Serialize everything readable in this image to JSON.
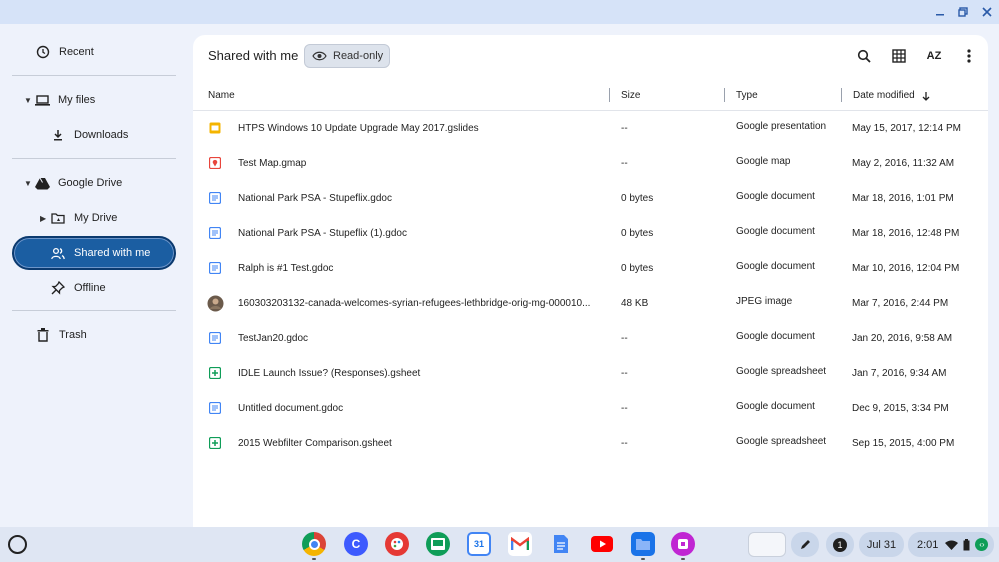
{
  "window": {
    "controls": [
      "minimize",
      "maximize",
      "close"
    ]
  },
  "sidebar": {
    "recent": "Recent",
    "my_files": "My files",
    "downloads": "Downloads",
    "google_drive": "Google Drive",
    "my_drive": "My Drive",
    "shared_with_me": "Shared with me",
    "offline": "Offline",
    "trash": "Trash"
  },
  "toolbar": {
    "title": "Shared with me",
    "read_only": "Read-only",
    "sort_label": "AZ"
  },
  "table": {
    "headers": {
      "name": "Name",
      "size": "Size",
      "type": "Type",
      "date": "Date modified"
    },
    "rows": [
      {
        "icon": "slides",
        "name": "HTPS Windows 10 Update Upgrade May 2017.gslides",
        "size": "--",
        "type": "Google presentation",
        "date": "May 15, 2017, 12:14 PM"
      },
      {
        "icon": "map",
        "name": "Test Map.gmap",
        "size": "--",
        "type": "Google map",
        "date": "May 2, 2016, 11:32 AM"
      },
      {
        "icon": "doc",
        "name": "National Park PSA - Stupeflix.gdoc",
        "size": "0 bytes",
        "type": "Google document",
        "date": "Mar 18, 2016, 1:01 PM"
      },
      {
        "icon": "doc",
        "name": "National Park PSA - Stupeflix (1).gdoc",
        "size": "0 bytes",
        "type": "Google document",
        "date": "Mar 18, 2016, 12:48 PM"
      },
      {
        "icon": "doc",
        "name": "Ralph is #1 Test.gdoc",
        "size": "0 bytes",
        "type": "Google document",
        "date": "Mar 10, 2016, 12:04 PM"
      },
      {
        "icon": "image",
        "name": "160303203132-canada-welcomes-syrian-refugees-lethbridge-orig-mg-000010...",
        "size": "48 KB",
        "type": "JPEG image",
        "date": "Mar 7, 2016, 2:44 PM"
      },
      {
        "icon": "doc",
        "name": "TestJan20.gdoc",
        "size": "--",
        "type": "Google document",
        "date": "Jan 20, 2016, 9:58 AM"
      },
      {
        "icon": "sheet",
        "name": "IDLE Launch Issue? (Responses).gsheet",
        "size": "--",
        "type": "Google spreadsheet",
        "date": "Jan 7, 2016, 9:34 AM"
      },
      {
        "icon": "doc",
        "name": "Untitled document.gdoc",
        "size": "--",
        "type": "Google document",
        "date": "Dec 9, 2015, 3:34 PM"
      },
      {
        "icon": "sheet",
        "name": "2015 Webfilter Comparison.gsheet",
        "size": "--",
        "type": "Google spreadsheet",
        "date": "Sep 15, 2015, 4:00 PM"
      }
    ]
  },
  "shelf": {
    "apps": [
      "chrome-icon",
      "canvas-icon",
      "paint-icon",
      "classroom-icon",
      "calendar-icon",
      "gmail-icon",
      "docs-icon",
      "youtube-icon",
      "files-icon",
      "screencast-icon"
    ],
    "calendar_day": "31",
    "canvas_letter": "C",
    "notification_count": "1",
    "date": "Jul 31",
    "time": "2:01"
  },
  "colors": {
    "accent": "#1b5ea2",
    "slides": "#f4b400",
    "map": "#e8453c",
    "doc": "#4285f4",
    "sheet": "#0f9d58"
  }
}
